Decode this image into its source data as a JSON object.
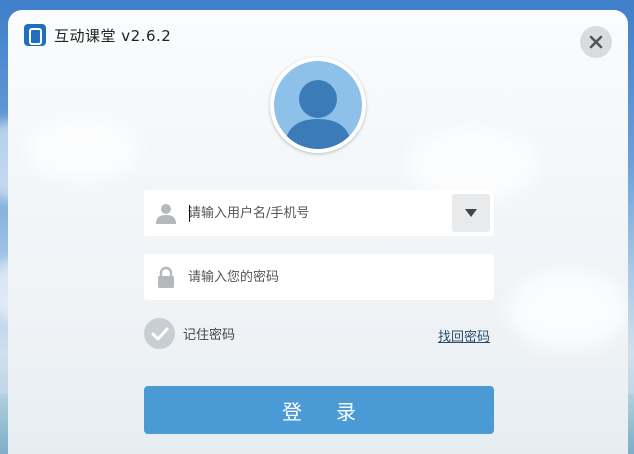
{
  "app": {
    "title": "互动课堂 v2.6.2",
    "logo_icon": "app-logo-icon",
    "close_icon": "close-icon"
  },
  "avatar": {
    "icon": "user-avatar-icon"
  },
  "username": {
    "placeholder": "请输入用户名/手机号",
    "value": "",
    "icon": "user-icon",
    "dropdown_icon": "dropdown-arrow-icon"
  },
  "password": {
    "placeholder": "请输入您的密码",
    "value": "",
    "icon": "lock-icon"
  },
  "remember": {
    "label": "记住密码",
    "icon": "checkmark-icon"
  },
  "forgot": {
    "label": "找回密码"
  },
  "login": {
    "label": "登录"
  },
  "colors": {
    "accent": "#4a9ad6",
    "logo": "#1f6fbf",
    "link": "#2a4c6c"
  }
}
